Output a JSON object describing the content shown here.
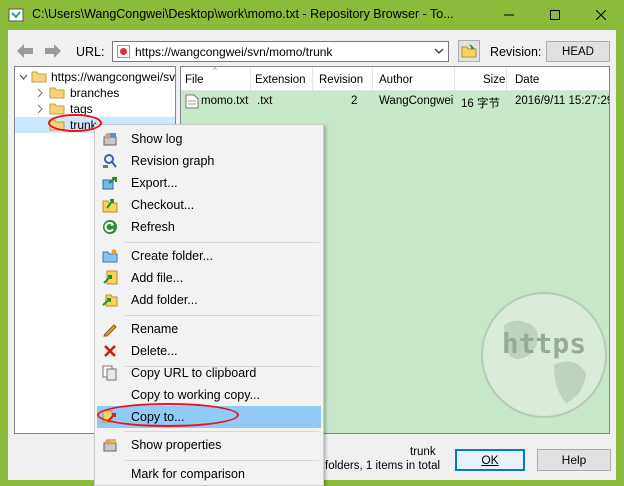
{
  "window": {
    "title": "C:\\Users\\WangCongwei\\Desktop\\work\\momo.txt - Repository Browser - To..."
  },
  "toolbar": {
    "url_label": "URL:",
    "url_value": "https://wangcongwei/svn/momo/trunk",
    "revision_label": "Revision:",
    "head_button": "HEAD"
  },
  "tree": {
    "root": "https://wangcongwei/svn",
    "items": [
      {
        "label": "branches"
      },
      {
        "label": "tags"
      },
      {
        "label": "trunk"
      }
    ]
  },
  "list": {
    "columns": [
      "File",
      "Extension",
      "Revision",
      "Author",
      "Size",
      "Date"
    ],
    "rows": [
      {
        "file": "momo.txt",
        "extension": ".txt",
        "revision": "2",
        "author": "WangCongwei",
        "size": "16 字节",
        "date": "2016/9/11 15:27:29"
      }
    ]
  },
  "status": {
    "selected": "trunk",
    "detail": "folders, 1 items in total"
  },
  "buttons": {
    "ok": "OK",
    "help": "Help"
  },
  "context_menu": {
    "items": [
      {
        "label": "Show log",
        "icon": "show-log-icon"
      },
      {
        "label": "Revision graph",
        "icon": "revision-graph-icon"
      },
      {
        "label": "Export...",
        "icon": "export-icon"
      },
      {
        "label": "Checkout...",
        "icon": "checkout-icon"
      },
      {
        "label": "Refresh",
        "icon": "refresh-icon"
      },
      {
        "label": "Create folder...",
        "icon": "create-folder-icon"
      },
      {
        "label": "Add file...",
        "icon": "add-file-icon"
      },
      {
        "label": "Add folder...",
        "icon": "add-folder-icon"
      },
      {
        "label": "Rename",
        "icon": "rename-icon"
      },
      {
        "label": "Delete...",
        "icon": "delete-icon"
      },
      {
        "label": "Copy URL to clipboard",
        "icon": "copy-url-icon"
      },
      {
        "label": "Copy to working copy...",
        "icon": ""
      },
      {
        "label": "Copy to...",
        "icon": "copy-to-icon"
      },
      {
        "label": "Show properties",
        "icon": "properties-icon"
      },
      {
        "label": "Mark for comparison",
        "icon": ""
      }
    ]
  },
  "watermark": "https"
}
